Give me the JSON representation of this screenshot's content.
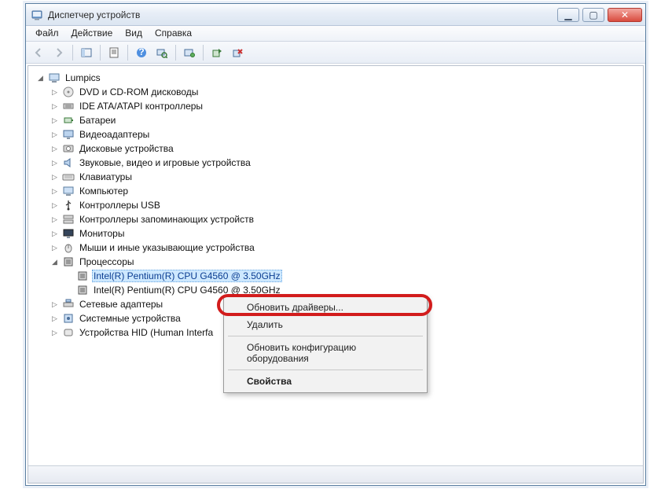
{
  "window": {
    "title": "Диспетчер устройств"
  },
  "menu": {
    "file": "Файл",
    "action": "Действие",
    "view": "Вид",
    "help": "Справка"
  },
  "toolbar_icons": {
    "back": "back-arrow-icon",
    "forward": "forward-arrow-icon",
    "up": "show-hidden-icon",
    "prop": "properties-icon",
    "help": "help-icon",
    "scan": "scan-icon",
    "console": "console-icon",
    "update": "update-driver-icon",
    "uninstall": "uninstall-icon"
  },
  "tree": {
    "root": "Lumpics",
    "nodes": [
      {
        "label": "DVD и CD-ROM дисководы",
        "icon": "disc"
      },
      {
        "label": "IDE ATA/ATAPI контроллеры",
        "icon": "ide"
      },
      {
        "label": "Батареи",
        "icon": "battery"
      },
      {
        "label": "Видеоадаптеры",
        "icon": "display"
      },
      {
        "label": "Дисковые устройства",
        "icon": "disk"
      },
      {
        "label": "Звуковые, видео и игровые устройства",
        "icon": "audio"
      },
      {
        "label": "Клавиатуры",
        "icon": "keyboard"
      },
      {
        "label": "Компьютер",
        "icon": "computer"
      },
      {
        "label": "Контроллеры USB",
        "icon": "usb"
      },
      {
        "label": "Контроллеры запоминающих устройств",
        "icon": "storage"
      },
      {
        "label": "Мониторы",
        "icon": "monitor"
      },
      {
        "label": "Мыши и иные указывающие устройства",
        "icon": "mouse"
      }
    ],
    "processors_label": "Процессоры",
    "processors": [
      "Intel(R) Pentium(R) CPU G4560 @ 3.50GHz",
      "Intel(R) Pentium(R) CPU G4560 @ 3.50GHz"
    ],
    "after": [
      {
        "label": "Сетевые адаптеры",
        "icon": "network"
      },
      {
        "label": "Системные устройства",
        "icon": "system"
      },
      {
        "label": "Устройства HID (Human Interface Devices)",
        "icon": "hid",
        "truncated": "Устройства HID (Human Interfa"
      }
    ]
  },
  "context_menu": {
    "update": "Обновить драйверы...",
    "remove": "Удалить",
    "refresh": "Обновить конфигурацию оборудования",
    "properties": "Свойства"
  }
}
